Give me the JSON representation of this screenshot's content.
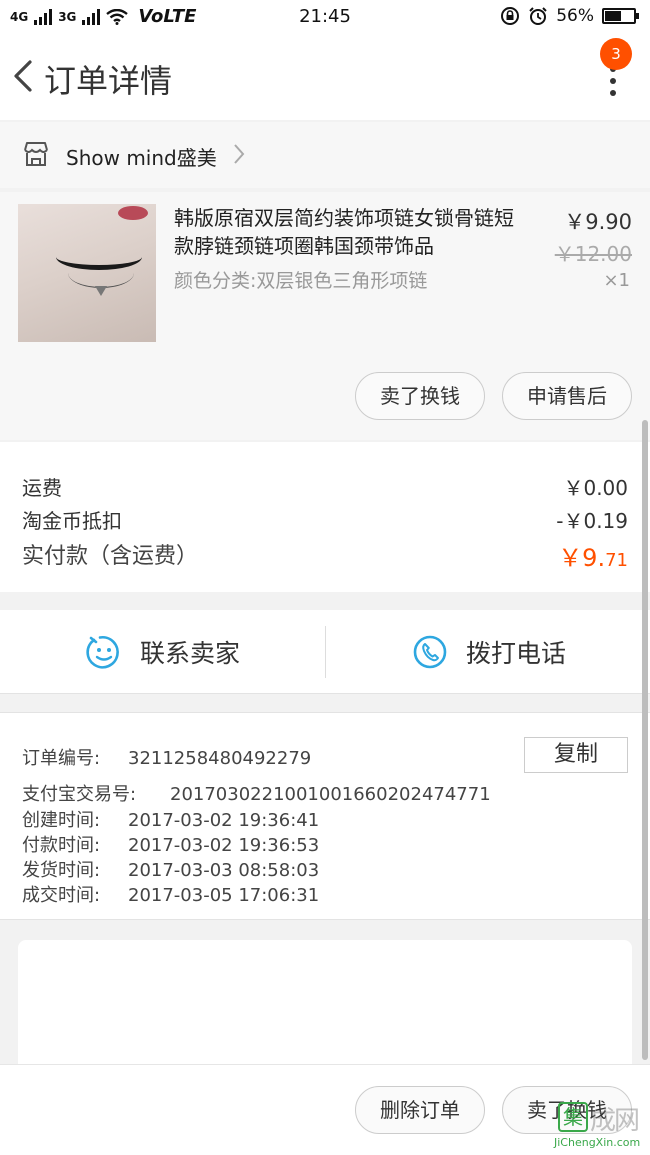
{
  "status_bar": {
    "signal_1": "4G",
    "signal_2": "3G",
    "volte": "VoLTE",
    "time": "21:45",
    "battery": "56%",
    "battery_level": 0.56
  },
  "header": {
    "title": "订单详情",
    "badge_count": "3"
  },
  "shop": {
    "name": "Show mind盛美"
  },
  "product": {
    "title": "韩版原宿双层简约装饰项链女锁骨链短款脖链颈链项圈韩国颈带饰品",
    "spec": "颜色分类:双层银色三角形项链",
    "price": "￥9.90",
    "original_price": "￥12.00",
    "quantity": "×1",
    "sell_button": "卖了换钱",
    "after_sale_button": "申请售后"
  },
  "fees": {
    "shipping_label": "运费",
    "shipping_value": "￥0.00",
    "coin_label": "淘金币抵扣",
    "coin_value": "-￥0.19",
    "total_label": "实付款（含运费）",
    "total_main": "￥9.",
    "total_decimal": "71"
  },
  "contact": {
    "seller_label": "联系卖家",
    "phone_label": "拨打电话"
  },
  "order_info": {
    "order_no_label": "订单编号:",
    "order_no": "3211258480492279",
    "copy_label": "复制",
    "alipay_label": "支付宝交易号:",
    "alipay_no": "2017030221001001660202474771",
    "created_label": "创建时间:",
    "created": "2017-03-02 19:36:41",
    "paid_label": "付款时间:",
    "paid": "2017-03-02 19:36:53",
    "shipped_label": "发货时间:",
    "shipped": "2017-03-03 08:58:03",
    "completed_label": "成交时间:",
    "completed": "2017-03-05 17:06:31"
  },
  "footer": {
    "delete_button": "删除订单",
    "sell_button": "卖了换钱"
  },
  "watermark": {
    "logo": "集",
    "text": "成网",
    "url": "JiChengXin.com"
  },
  "colors": {
    "accent": "#ff5000",
    "icon_blue": "#2ea7e0"
  }
}
